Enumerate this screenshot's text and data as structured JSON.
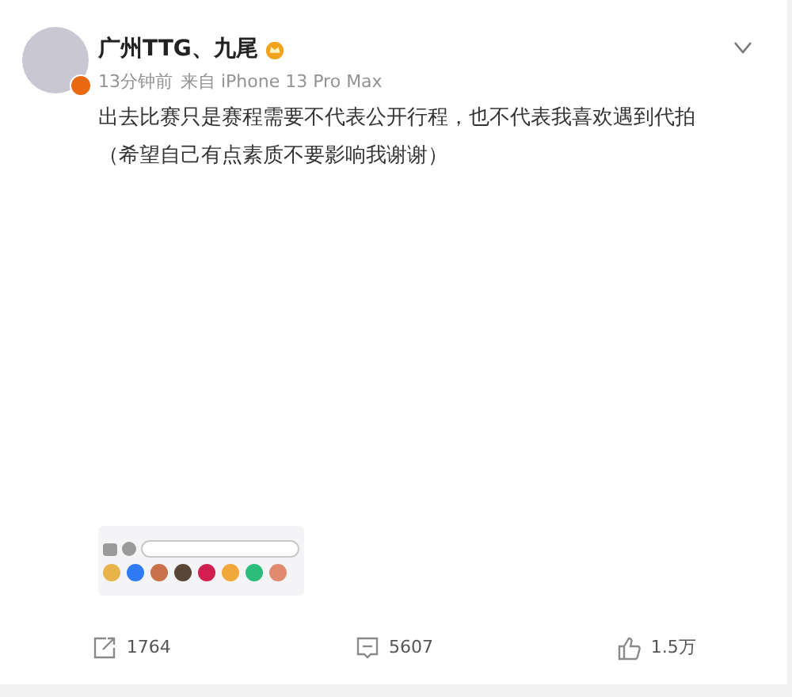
{
  "post": {
    "author": "广州TTG、九尾",
    "time": "13分钟前",
    "source": "来自 iPhone 13 Pro Max",
    "text": "出去比赛只是赛程需要不代表公开行程，也不代表我喜欢遇到代拍（希望自己有点素质不要影响我谢谢）",
    "verified": true
  },
  "actions": [
    {
      "kind": "repost",
      "count": "1764"
    },
    {
      "kind": "comment",
      "count": "5607"
    },
    {
      "kind": "like",
      "count": "1.5万"
    }
  ]
}
